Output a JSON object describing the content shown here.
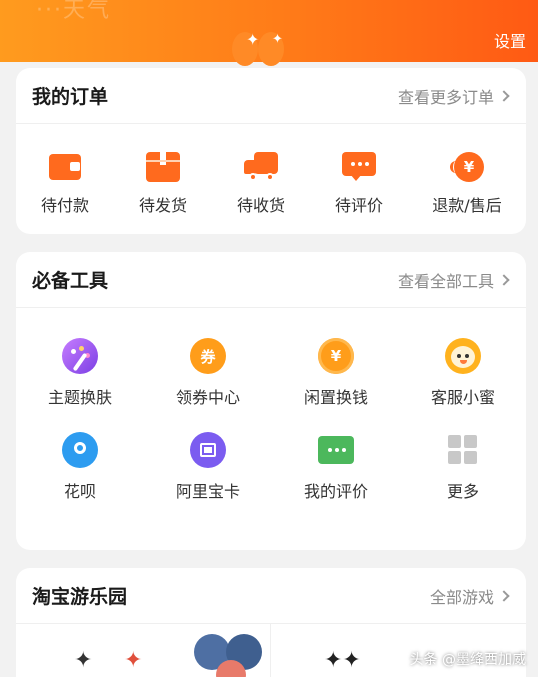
{
  "header": {
    "faded_text": "···天气",
    "settings_label": "设置"
  },
  "orders": {
    "title": "我的订单",
    "more_label": "查看更多订单",
    "items": [
      {
        "label": "待付款",
        "icon": "wallet-icon"
      },
      {
        "label": "待发货",
        "icon": "package-icon"
      },
      {
        "label": "待收货",
        "icon": "truck-icon"
      },
      {
        "label": "待评价",
        "icon": "comment-icon"
      },
      {
        "label": "退款/售后",
        "icon": "refund-icon"
      }
    ]
  },
  "tools": {
    "title": "必备工具",
    "more_label": "查看全部工具",
    "items": [
      {
        "label": "主题换肤",
        "icon": "palette-icon",
        "color": "#a35be0"
      },
      {
        "label": "领券中心",
        "icon": "coupon-icon",
        "color": "#ff9d1a",
        "glyph": "券"
      },
      {
        "label": "闲置换钱",
        "icon": "yen-coin-icon",
        "color": "#ff9d1a",
        "glyph": "¥"
      },
      {
        "label": "客服小蜜",
        "icon": "bee-mascot-icon",
        "color": "#ffb21e"
      },
      {
        "label": "花呗",
        "icon": "huabei-icon",
        "color": "#2d9cf0"
      },
      {
        "label": "阿里宝卡",
        "icon": "sim-card-icon",
        "color": "#7b5cf0"
      },
      {
        "label": "我的评价",
        "icon": "review-icon",
        "color": "#4cb85c"
      },
      {
        "label": "更多",
        "icon": "grid-more-icon",
        "color": "#c8c8c8"
      }
    ]
  },
  "park": {
    "title": "淘宝游乐园",
    "more_label": "全部游戏"
  },
  "watermark": "头条 @墨绛西加威"
}
